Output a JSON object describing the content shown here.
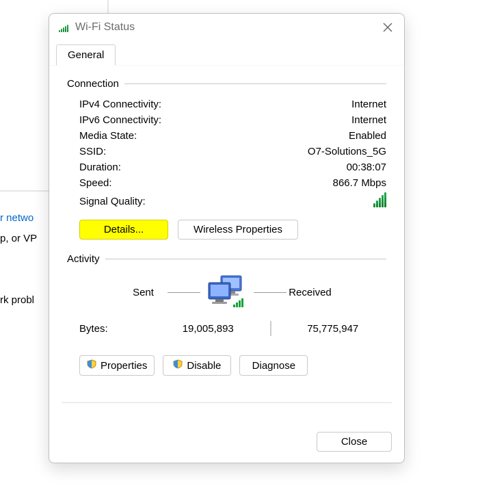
{
  "background": {
    "link_fragment": "r netwo",
    "text1_fragment": "p, or VP",
    "text2_fragment": "rk probl"
  },
  "dialog": {
    "title": "Wi-Fi Status",
    "tab_general": "General",
    "group_connection": "Connection",
    "ipv4_label": "IPv4 Connectivity:",
    "ipv4_value": "Internet",
    "ipv6_label": "IPv6 Connectivity:",
    "ipv6_value": "Internet",
    "media_label": "Media State:",
    "media_value": "Enabled",
    "ssid_label": "SSID:",
    "ssid_value": "O7-Solutions_5G",
    "duration_label": "Duration:",
    "duration_value": "00:38:07",
    "speed_label": "Speed:",
    "speed_value": "866.7 Mbps",
    "signal_label": "Signal Quality:",
    "details_btn": "Details...",
    "wireless_btn": "Wireless Properties",
    "group_activity": "Activity",
    "sent_label": "Sent",
    "received_label": "Received",
    "bytes_label": "Bytes:",
    "bytes_sent": "19,005,893",
    "bytes_received": "75,775,947",
    "properties_btn": "Properties",
    "disable_btn": "Disable",
    "diagnose_btn": "Diagnose",
    "close_btn": "Close"
  }
}
